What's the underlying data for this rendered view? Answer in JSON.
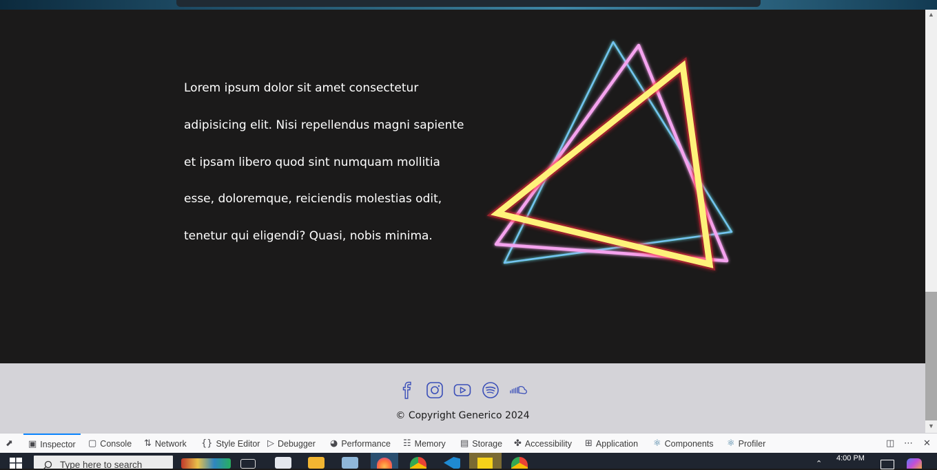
{
  "content": {
    "paragraph_lines": [
      "Lorem ipsum dolor sit amet consectetur",
      "adipisicing elit. Nisi repellendus magni sapiente",
      "et ipsam libero quod sint numquam mollitia",
      "esse, doloremque, reiciendis molestias odit,",
      "tenetur qui eligendi? Quasi, nobis minima."
    ]
  },
  "footer": {
    "social_icons": [
      "facebook-icon",
      "instagram-icon",
      "youtube-icon",
      "spotify-icon",
      "soundcloud-icon"
    ],
    "copyright": "© Copyright Generico 2024"
  },
  "devtools": {
    "tabs": [
      {
        "label": "Inspector",
        "icon": "inspector-icon",
        "active": true
      },
      {
        "label": "Console",
        "icon": "console-icon"
      },
      {
        "label": "Network",
        "icon": "network-icon"
      },
      {
        "label": "Style Editor",
        "icon": "style-editor-icon"
      },
      {
        "label": "Debugger",
        "icon": "debugger-icon"
      },
      {
        "label": "Performance",
        "icon": "performance-icon"
      },
      {
        "label": "Memory",
        "icon": "memory-icon"
      },
      {
        "label": "Storage",
        "icon": "storage-icon"
      },
      {
        "label": "Accessibility",
        "icon": "accessibility-icon"
      },
      {
        "label": "Application",
        "icon": "application-icon"
      },
      {
        "label": "Components",
        "icon": "react-icon"
      },
      {
        "label": "Profiler",
        "icon": "react-icon"
      }
    ]
  },
  "taskbar": {
    "search_placeholder": "Type here to search",
    "clock": "4:00 PM"
  },
  "colors": {
    "page_bg": "#1b1a1a",
    "footer_bg": "#d4d3d8",
    "social_icon": "#3b4fb8",
    "accent_tab": "#0a84ff",
    "triangle_yellow": "#fff27a",
    "triangle_pink": "#f7a6f0",
    "triangle_cyan": "#7ee7f5"
  }
}
